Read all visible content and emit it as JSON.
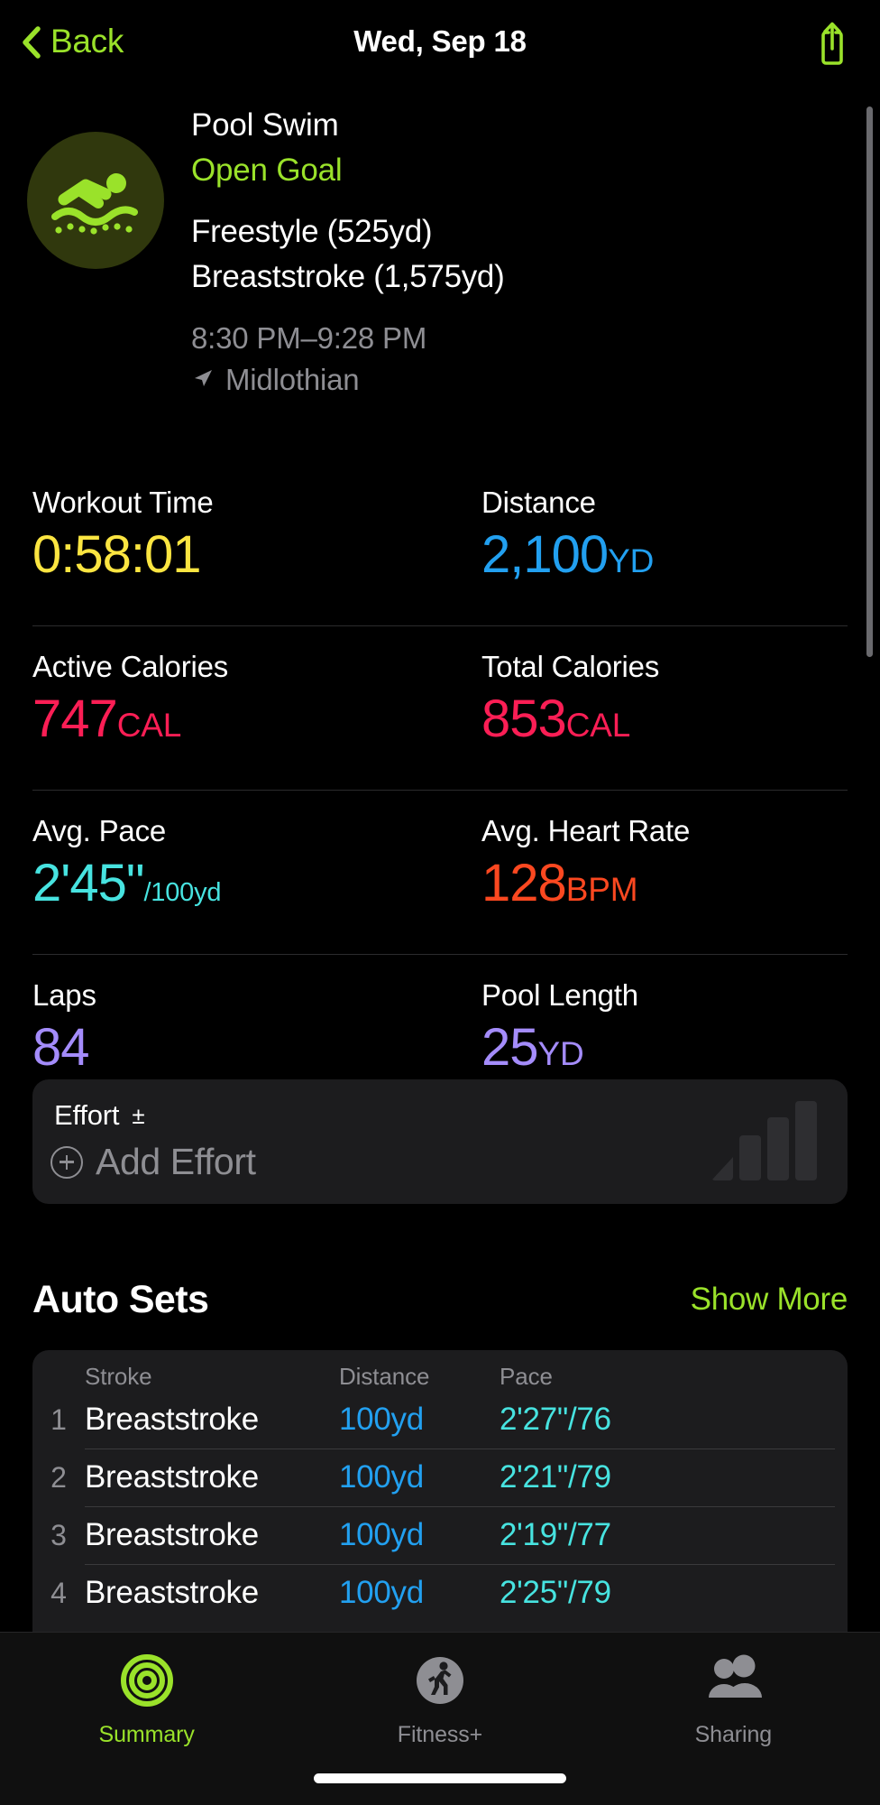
{
  "navbar": {
    "back_label": "Back",
    "title": "Wed, Sep 18",
    "share_icon": "share-icon",
    "back_icon": "chevron-left-icon"
  },
  "header": {
    "icon": "pool-swim-icon",
    "workout_type": "Pool Swim",
    "goal": "Open Goal",
    "strokes": [
      "Freestyle (525yd)",
      "Breaststroke (1,575yd)"
    ],
    "time_range": "8:30 PM–9:28 PM",
    "location": "Midlothian",
    "location_icon": "location-arrow-icon"
  },
  "metrics": [
    [
      {
        "label": "Workout Time",
        "value": "0:58:01",
        "unit": "",
        "unit_small": "",
        "color": "#fbe541"
      },
      {
        "label": "Distance",
        "value": "2,100",
        "unit": "YD",
        "unit_small": "",
        "color": "#22a0f0"
      }
    ],
    [
      {
        "label": "Active Calories",
        "value": "747",
        "unit": "CAL",
        "unit_small": "",
        "color": "#fb1e55"
      },
      {
        "label": "Total Calories",
        "value": "853",
        "unit": "CAL",
        "unit_small": "",
        "color": "#fb1e55"
      }
    ],
    [
      {
        "label": "Avg. Pace",
        "value": "2'45\"",
        "unit": "",
        "unit_small": "/100yd",
        "color": "#47e3e0"
      },
      {
        "label": "Avg. Heart Rate",
        "value": "128",
        "unit": "BPM",
        "unit_small": "",
        "color": "#fb4820"
      }
    ],
    [
      {
        "label": "Laps",
        "value": "84",
        "unit": "",
        "unit_small": "",
        "color": "#a48cfb"
      },
      {
        "label": "Pool Length",
        "value": "25",
        "unit": "YD",
        "unit_small": "",
        "color": "#a48cfb"
      }
    ]
  ],
  "effort": {
    "title": "Effort",
    "plus_minus": "±",
    "add_label": "Add Effort",
    "add_icon": "plus-circle-icon",
    "bars_icon": "effort-bars-icon"
  },
  "auto_sets": {
    "title": "Auto Sets",
    "show_more": "Show More",
    "columns": {
      "index": "",
      "stroke": "Stroke",
      "distance": "Distance",
      "pace": "Pace"
    },
    "rows": [
      {
        "index": "1",
        "stroke": "Breaststroke",
        "distance": "100yd",
        "pace": "2'27\"/76"
      },
      {
        "index": "2",
        "stroke": "Breaststroke",
        "distance": "100yd",
        "pace": "2'21\"/79"
      },
      {
        "index": "3",
        "stroke": "Breaststroke",
        "distance": "100yd",
        "pace": "2'19\"/77"
      },
      {
        "index": "4",
        "stroke": "Breaststroke",
        "distance": "100yd",
        "pace": "2'25\"/79"
      }
    ]
  },
  "tabbar": {
    "tabs": [
      {
        "label": "Summary",
        "icon": "activity-rings-icon",
        "active": true
      },
      {
        "label": "Fitness+",
        "icon": "runner-icon",
        "active": false
      },
      {
        "label": "Sharing",
        "icon": "people-icon",
        "active": false
      }
    ]
  },
  "colors": {
    "accent_green": "#9ae22a",
    "background": "#000000",
    "card": "#1c1c1e"
  }
}
